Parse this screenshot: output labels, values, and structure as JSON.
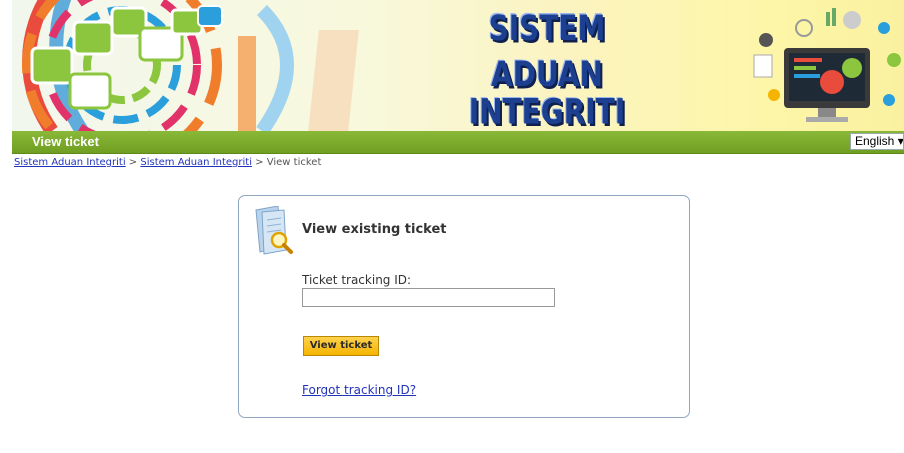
{
  "banner": {
    "title_line1": "SISTEM",
    "title_line2": "ADUAN INTEGRITI"
  },
  "titlebar": {
    "title": "View ticket",
    "language": "English ▾"
  },
  "breadcrumb": {
    "item1": "Sistem Aduan Integriti",
    "sep1": " > ",
    "item2": "Sistem Aduan Integriti",
    "sep2": " > ",
    "current": "View ticket"
  },
  "form": {
    "heading": "View existing ticket",
    "tracking_label": "Ticket tracking ID:",
    "tracking_value": "",
    "submit_label": "View ticket",
    "forgot_link": "Forgot tracking ID?"
  },
  "colors": {
    "titlebar_green": "#7aab2b",
    "link_blue": "#2233bb",
    "button_yellow": "#f5b400",
    "box_border": "#8fa6c2"
  },
  "icons": [
    "document-search-icon",
    "banner-decoration-graphic",
    "banner-devices-graphic",
    "dropdown-caret-icon"
  ]
}
